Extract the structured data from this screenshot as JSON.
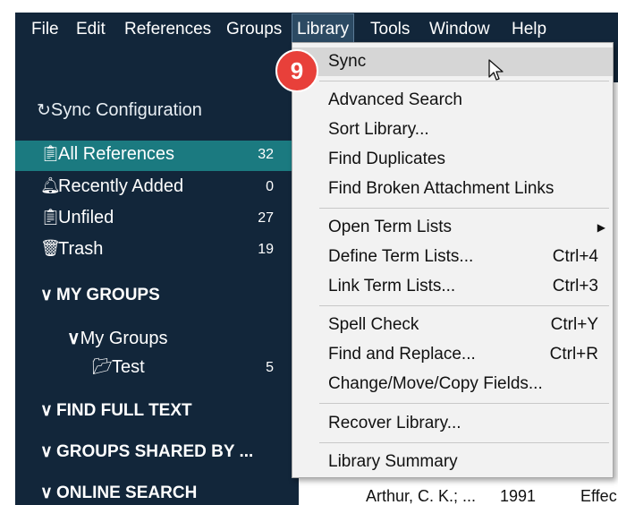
{
  "menubar": {
    "items": [
      "File",
      "Edit",
      "References",
      "Groups",
      "Library",
      "Tools",
      "Window",
      "Help"
    ],
    "active": "Library"
  },
  "sidebar": {
    "sync_configuration": "Sync Configuration",
    "items": [
      {
        "label": "All References",
        "count": "32",
        "icon": "clipboard-icon",
        "selected": true
      },
      {
        "label": "Recently Added",
        "count": "0",
        "icon": "bell-icon",
        "selected": false
      },
      {
        "label": "Unfiled",
        "count": "27",
        "icon": "clipboard-icon",
        "selected": false
      },
      {
        "label": "Trash",
        "count": "19",
        "icon": "trash-icon",
        "selected": false
      }
    ],
    "my_groups_header": "MY GROUPS",
    "my_groups_sub": "My Groups",
    "group_test": {
      "label": "Test",
      "count": "5"
    },
    "find_full_text": "FIND FULL TEXT",
    "groups_shared_by": "GROUPS SHARED BY ...",
    "online_search": "ONLINE SEARCH"
  },
  "content": {
    "author": "Arthur, C. K.; ...",
    "year": "1991",
    "title_fragment": "Effec"
  },
  "dropdown": {
    "items": [
      {
        "label": "Sync",
        "shortcut": ""
      },
      {
        "label": "Advanced Search",
        "shortcut": ""
      },
      {
        "label": "Sort Library...",
        "shortcut": ""
      },
      {
        "label": "Find Duplicates",
        "shortcut": ""
      },
      {
        "label": "Find Broken Attachment Links",
        "shortcut": ""
      },
      {
        "label": "Open Term Lists",
        "shortcut": ""
      },
      {
        "label": "Define Term Lists...",
        "shortcut": "Ctrl+4"
      },
      {
        "label": "Link Term Lists...",
        "shortcut": "Ctrl+3"
      },
      {
        "label": "Spell Check",
        "shortcut": "Ctrl+Y"
      },
      {
        "label": "Find and Replace...",
        "shortcut": "Ctrl+R"
      },
      {
        "label": "Change/Move/Copy Fields...",
        "shortcut": ""
      },
      {
        "label": "Recover Library...",
        "shortcut": ""
      },
      {
        "label": "Library Summary",
        "shortcut": ""
      }
    ]
  },
  "badge": {
    "number": "9"
  },
  "colors": {
    "menubar_bg": "#12263a",
    "sidebar_bg": "#12263a",
    "selected_bg": "#1b7a80",
    "badge_red": "#e8403a",
    "dropdown_bg": "#f2f2f2"
  }
}
